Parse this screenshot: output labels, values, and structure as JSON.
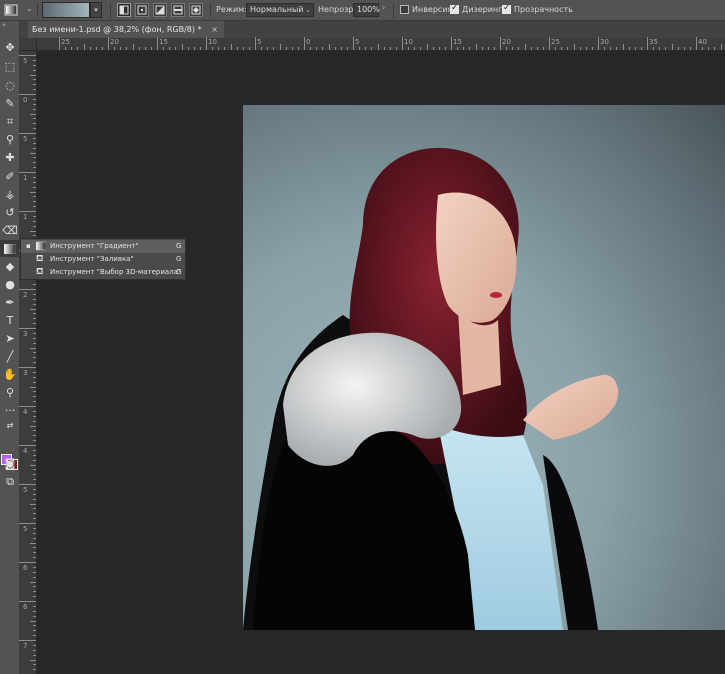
{
  "options_bar": {
    "mode_label": "Режим:",
    "mode_value": "Нормальный",
    "opacity_label": "Непрозр.:",
    "opacity_value": "100%",
    "inverse_label": "Инверсия",
    "dither_label": "Дизеринг",
    "transparency_label": "Прозрачность",
    "inverse_checked": false,
    "dither_checked": true,
    "transparency_checked": true
  },
  "document": {
    "tab_title": "Без имени-1.psd @ 38,2% (фон, RGB/8) *",
    "close_glyph": "×"
  },
  "ruler": {
    "top_labels": [
      "25",
      "20",
      "15",
      "10",
      "5",
      "0",
      "5",
      "10",
      "15",
      "20",
      "25",
      "30",
      "35",
      "40"
    ],
    "left_labels": [
      "5",
      "0",
      "5",
      "1",
      "1",
      "2",
      "2",
      "3",
      "3",
      "4",
      "4",
      "5",
      "5",
      "6",
      "6",
      "7"
    ]
  },
  "flyout": {
    "items": [
      {
        "label": "Инструмент \"Градиент\"",
        "shortcut": "G",
        "active": true,
        "icon": "gradient-icon"
      },
      {
        "label": "Инструмент \"Заливка\"",
        "shortcut": "G",
        "active": false,
        "icon": "paint-bucket-icon"
      },
      {
        "label": "Инструмент \"Выбор 3D-материала\"",
        "shortcut": "G",
        "active": false,
        "icon": "3d-material-drop-icon"
      }
    ]
  },
  "colors": {
    "foreground": "#b85cf0",
    "background": "#6e2618",
    "ui_panel": "#535353",
    "canvas_bg": "#282828"
  }
}
